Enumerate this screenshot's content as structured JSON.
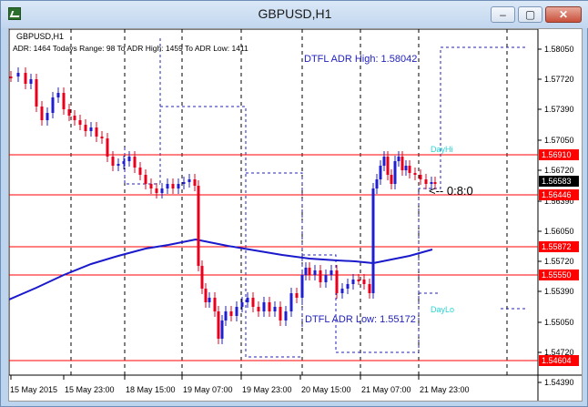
{
  "window": {
    "title": "GBPUSD,H1",
    "minimize_glyph": "–",
    "maximize_glyph": "▢",
    "close_glyph": "✕"
  },
  "chart": {
    "symbol_label": "GBPUSD,H1",
    "indicator_text": "ADR: 1464  Todays Range: 98  To ADR High: 1459  To ADR Low: 1411",
    "adr_high_label": "DTFL ADR High: 1.58042",
    "adr_low_label": "DTFL ADR Low: 1.55172",
    "dayhi_label": "DayHi",
    "daylo_label": "DayLo",
    "pips_label": "<-- 0:8:0",
    "price_ticks": [
      "1.58050",
      "1.57720",
      "1.57390",
      "1.57050",
      "1.56720",
      "1.56390",
      "1.56050",
      "1.55720",
      "1.55390",
      "1.55050",
      "1.54720",
      "1.54390"
    ],
    "time_ticks": [
      "15 May 2015",
      "15 May 23:00",
      "18 May 15:00",
      "19 May 07:00",
      "19 May 23:00",
      "20 May 15:00",
      "21 May 07:00",
      "21 May 23:00"
    ],
    "level_lines": [
      {
        "price": "1.56910",
        "color": "#ff0000",
        "text_color": "#ffffff"
      },
      {
        "price": "1.56583",
        "color": "#000000",
        "text_color": "#ffffff"
      },
      {
        "price": "1.56446",
        "color": "#ff0000",
        "text_color": "#ffffff"
      },
      {
        "price": "1.55872",
        "color": "#ff0000",
        "text_color": "#ffffff"
      },
      {
        "price": "1.55550",
        "color": "#ff0000",
        "text_color": "#ffffff"
      },
      {
        "price": "1.54604",
        "color": "#ff0000",
        "text_color": "#ffffff"
      }
    ],
    "colors": {
      "bull": "#1f1fd0",
      "bear": "#e8001c",
      "ma": "#1a1acc",
      "adr_text": "#2222bb",
      "day_text": "#2ad4d4",
      "grid": "#000000"
    }
  }
}
